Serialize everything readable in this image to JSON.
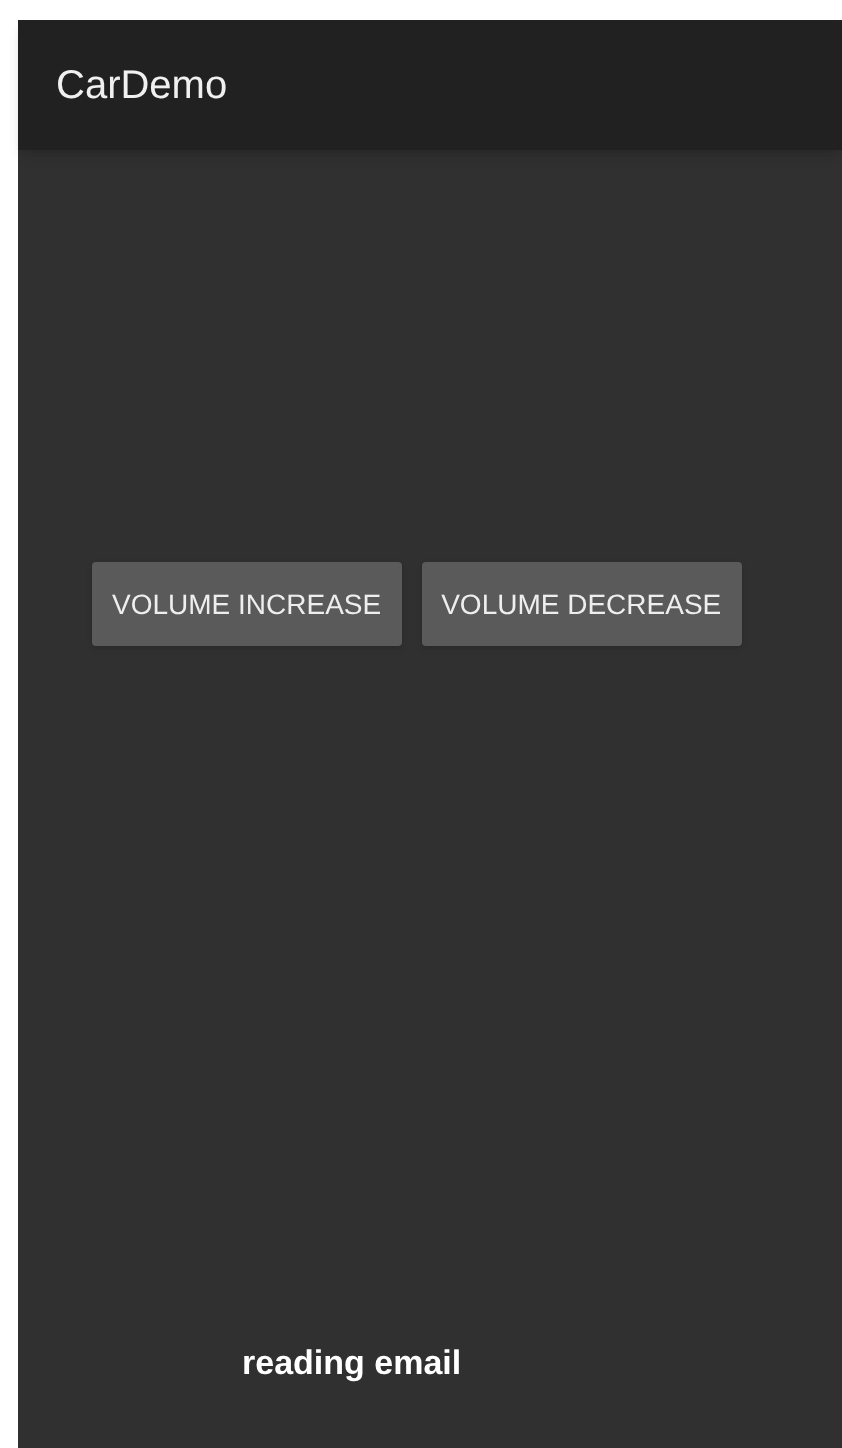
{
  "app_bar": {
    "title": "CarDemo"
  },
  "buttons": [
    "VOLUME INCREASE",
    "VOLUME DECREASE"
  ],
  "status_text": "reading email"
}
